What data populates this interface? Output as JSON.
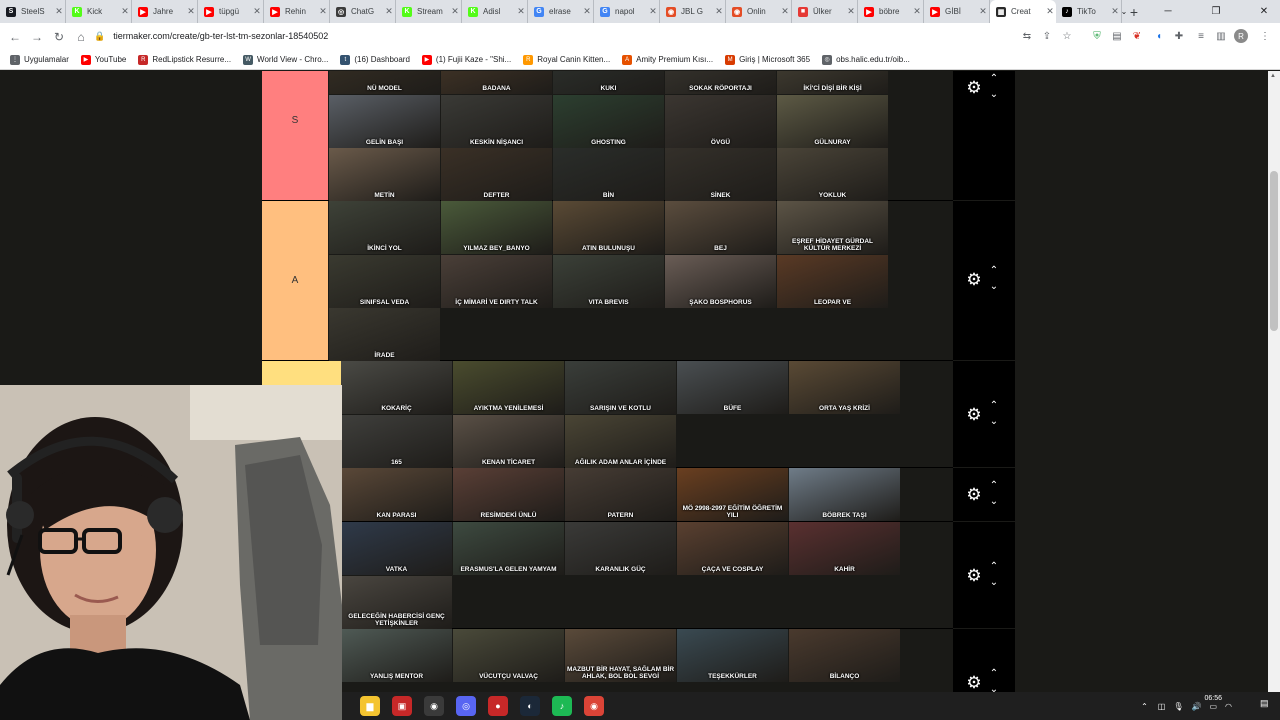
{
  "browser": {
    "tabs": [
      {
        "title": "SteelS",
        "color": "#171a21",
        "glyph": "S"
      },
      {
        "title": "Kick",
        "color": "#53fc18",
        "glyph": "K"
      },
      {
        "title": "Jahre",
        "color": "#ff0000",
        "glyph": "▶"
      },
      {
        "title": "tüpgü",
        "color": "#ff0000",
        "glyph": "▶"
      },
      {
        "title": "Rehin",
        "color": "#ff0000",
        "glyph": "▶"
      },
      {
        "title": "ChatG",
        "color": "#3c3c3c",
        "glyph": "◎"
      },
      {
        "title": "Stream",
        "color": "#53fc18",
        "glyph": "K"
      },
      {
        "title": "Adisl",
        "color": "#53fc18",
        "glyph": "K"
      },
      {
        "title": "elrase",
        "color": "#4285f4",
        "glyph": "G"
      },
      {
        "title": "napol",
        "color": "#4285f4",
        "glyph": "G"
      },
      {
        "title": "JBL G",
        "color": "#e44d26",
        "glyph": "◉"
      },
      {
        "title": "Onlin",
        "color": "#e44d26",
        "glyph": "◉"
      },
      {
        "title": "Ülker",
        "color": "#e53935",
        "glyph": "■"
      },
      {
        "title": "böbre",
        "color": "#ff0000",
        "glyph": "▶"
      },
      {
        "title": "GİBİ",
        "color": "#ff0000",
        "glyph": "▶"
      },
      {
        "title": "Creat",
        "color": "#2b2b2b",
        "glyph": "▦",
        "active": true
      },
      {
        "title": "TikTo",
        "color": "#000000",
        "glyph": "♪"
      }
    ],
    "url": "tiermaker.com/create/gb-ter-lst-tm-sezonlar-18540502",
    "bookmarks": [
      {
        "label": "Uygulamalar",
        "color": "#5f6368",
        "glyph": "⋮"
      },
      {
        "label": "YouTube",
        "color": "#ff0000",
        "glyph": "▶"
      },
      {
        "label": "RedLipstick Resurre...",
        "color": "#c62828",
        "glyph": "R"
      },
      {
        "label": "World View - Chro...",
        "color": "#455a64",
        "glyph": "W"
      },
      {
        "label": "(16) Dashboard",
        "color": "#34526f",
        "glyph": "t"
      },
      {
        "label": "(1) Fujii Kaze - \"Shi...",
        "color": "#ff0000",
        "glyph": "▶"
      },
      {
        "label": "Royal Canin Kitten...",
        "color": "#ff9800",
        "glyph": "R"
      },
      {
        "label": "Amity Premium Kısı...",
        "color": "#e65100",
        "glyph": "A"
      },
      {
        "label": "Giriş | Microsoft 365",
        "color": "#d83b01",
        "glyph": "M"
      },
      {
        "label": "obs.halic.edu.tr/oib...",
        "color": "#5f6368",
        "glyph": "◎"
      }
    ]
  },
  "tiers": [
    {
      "label": "S",
      "color": "#ff7f7f",
      "items": [
        {
          "title": "NÜ MODEL",
          "bg": "#3a3226"
        },
        {
          "title": "BADANA",
          "bg": "#4a3a2a"
        },
        {
          "title": "KUKI",
          "bg": "#2f3430"
        },
        {
          "title": "SOKAK RÖPORTAJI",
          "bg": "#3d3a33"
        },
        {
          "title": "İKİ'Cİ DİŞİ BİR KİŞİ",
          "bg": "#4a4538"
        },
        {
          "title": "GELİN BAŞI",
          "bg": "#5a5f66"
        },
        {
          "title": "KESKİN NİŞANCI",
          "bg": "#3a3a36"
        },
        {
          "title": "GHOSTING",
          "bg": "#2c3f30"
        },
        {
          "title": "ÖVGÜ",
          "bg": "#3b3631"
        },
        {
          "title": "GÜLNURAY",
          "bg": "#5d5a45"
        },
        {
          "title": "METİN",
          "bg": "#6a5a4a"
        },
        {
          "title": "DEFTER",
          "bg": "#3a3026"
        },
        {
          "title": "BİN",
          "bg": "#2a2d2a"
        },
        {
          "title": "SİNEK",
          "bg": "#34302a"
        },
        {
          "title": "YOKLUK",
          "bg": "#4a4438"
        }
      ]
    },
    {
      "label": "A",
      "color": "#ffbf7f",
      "items": [
        {
          "title": "İKİNCİ YOL",
          "bg": "#3e4238"
        },
        {
          "title": "YILMAZ BEY_BANYO",
          "bg": "#4a5a3a"
        },
        {
          "title": "ATIN BULUNUŞU",
          "bg": "#5a4a35"
        },
        {
          "title": "BEJ",
          "bg": "#5b4d3e"
        },
        {
          "title": "EŞREF HİDAYET GÜRDAL KÜLTÜR MERKEZİ",
          "bg": "#5c5446"
        },
        {
          "title": "SINIFSAL VEDA",
          "bg": "#3a3a30"
        },
        {
          "title": "İÇ MİMARİ VE DIRTY TALK",
          "bg": "#4a3f38"
        },
        {
          "title": "VITA BREVIS",
          "bg": "#3b4038"
        },
        {
          "title": "ŞAKO BOSPHORUS",
          "bg": "#6a5d56"
        },
        {
          "title": "LEOPAR VE",
          "bg": "#5a3a25"
        },
        {
          "title": "İRADE",
          "bg": "#3a3830"
        }
      ]
    },
    {
      "label": "",
      "color": "#ffdf7f",
      "items": [
        {
          "title": "KOKARİÇ",
          "bg": "#4a4a45"
        },
        {
          "title": "AYIKTMA YENİLEMESİ",
          "bg": "#4a4c2e"
        },
        {
          "title": "SARIŞIN VE KOTLU",
          "bg": "#3a3e3a"
        },
        {
          "title": "BÜFE",
          "bg": "#4a4f52"
        },
        {
          "title": "ORTA YAŞ KRİZİ",
          "bg": "#5a4a35"
        },
        {
          "title": "165",
          "bg": "#3f3f3c"
        },
        {
          "title": "KENAN TİCARET",
          "bg": "#5a5046"
        },
        {
          "title": "AĞILIK ADAM ANLAR İÇİNDE",
          "bg": "#4a4535"
        }
      ]
    },
    {
      "label": "",
      "color": "#ffff7f",
      "items": [
        {
          "title": "KAN PARASI",
          "bg": "#5a4838"
        },
        {
          "title": "RESİMDEKİ ÜNLÜ",
          "bg": "#5a3f36"
        },
        {
          "title": "PATERN",
          "bg": "#463c34"
        },
        {
          "title": "MÖ 2998-2997 EĞİTİM ÖĞRETİM YILI",
          "bg": "#6a3f20"
        },
        {
          "title": "BÖBREK TAŞI",
          "bg": "#6f7c88"
        }
      ]
    },
    {
      "label": "",
      "color": "#bfff7f",
      "items": [
        {
          "title": "VATKA",
          "bg": "#2f3a4a"
        },
        {
          "title": "ERASMUS'LA GELEN YAMYAM",
          "bg": "#3d4a40"
        },
        {
          "title": "KARANLIK GÜÇ",
          "bg": "#3a3a38"
        },
        {
          "title": "ÇAÇA VE COSPLAY",
          "bg": "#5a4030"
        },
        {
          "title": "KAHİR",
          "bg": "#5a3030"
        },
        {
          "title": "GELECEĞİN HABERCİSİ GENÇ YETİŞKİNLER",
          "bg": "#4a4640"
        }
      ]
    },
    {
      "label": "",
      "color": "#7fff7f",
      "items": [
        {
          "title": "YANLIŞ MENTOR",
          "bg": "#4f5a55"
        },
        {
          "title": "VÜCUTÇU VALVAÇ",
          "bg": "#4a4a3a"
        },
        {
          "title": "MAZBUT BİR HAYAT, SAĞLAM BİR AHLAK, BOL BOL SEVGİ",
          "bg": "#5a4a3a"
        },
        {
          "title": "TEŞEKKÜRLER",
          "bg": "#3a4a52"
        },
        {
          "title": "BİLANÇO",
          "bg": "#4a3a2e"
        }
      ]
    }
  ],
  "taskbar": {
    "icons": [
      {
        "name": "file-explorer-icon",
        "color": "#f4c430",
        "glyph": "▆"
      },
      {
        "name": "video-app-icon",
        "color": "#c62828",
        "glyph": "▣"
      },
      {
        "name": "obs-icon",
        "color": "#3a3a3a",
        "glyph": "◉"
      },
      {
        "name": "discord-icon",
        "color": "#5865f2",
        "glyph": "◎"
      },
      {
        "name": "record-app-icon",
        "color": "#c62828",
        "glyph": "●"
      },
      {
        "name": "steam-icon",
        "color": "#1b2838",
        "glyph": "◐"
      },
      {
        "name": "spotify-icon",
        "color": "#1db954",
        "glyph": "♪"
      },
      {
        "name": "chrome-icon",
        "color": "#db4437",
        "glyph": "◉"
      }
    ],
    "time": "06:56"
  }
}
